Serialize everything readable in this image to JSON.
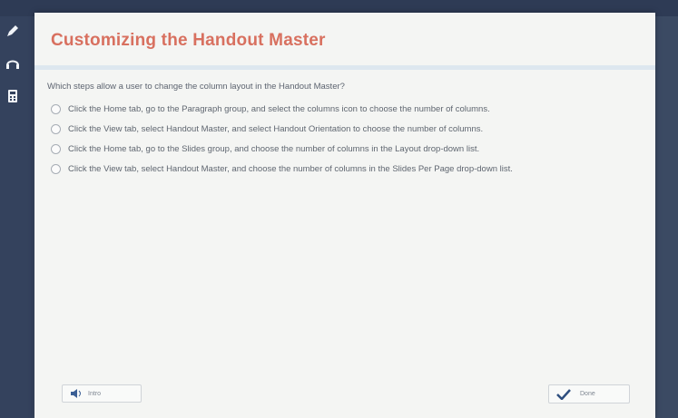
{
  "title": "Customizing the Handout Master",
  "question": "Which steps allow a user to change the column layout in the Handout Master?",
  "options": [
    "Click the Home tab, go to the Paragraph group, and select the columns icon to choose the number of columns.",
    "Click the View tab, select Handout Master, and select Handout Orientation to choose the number of columns.",
    "Click the Home tab, go to the Slides group, and choose the number of columns in the Layout drop-down list.",
    "Click the View tab, select Handout Master, and choose the number of columns in the Slides Per Page drop-down list."
  ],
  "buttons": {
    "intro": "Intro",
    "done": "Done"
  },
  "icons": {
    "pencil": "pencil-icon",
    "headphones": "headphones-icon",
    "calculator": "calculator-icon",
    "speaker": "speaker-icon",
    "check": "check-icon"
  },
  "colors": {
    "title": "#d8705f",
    "accent_check": "#2f4f7f"
  }
}
